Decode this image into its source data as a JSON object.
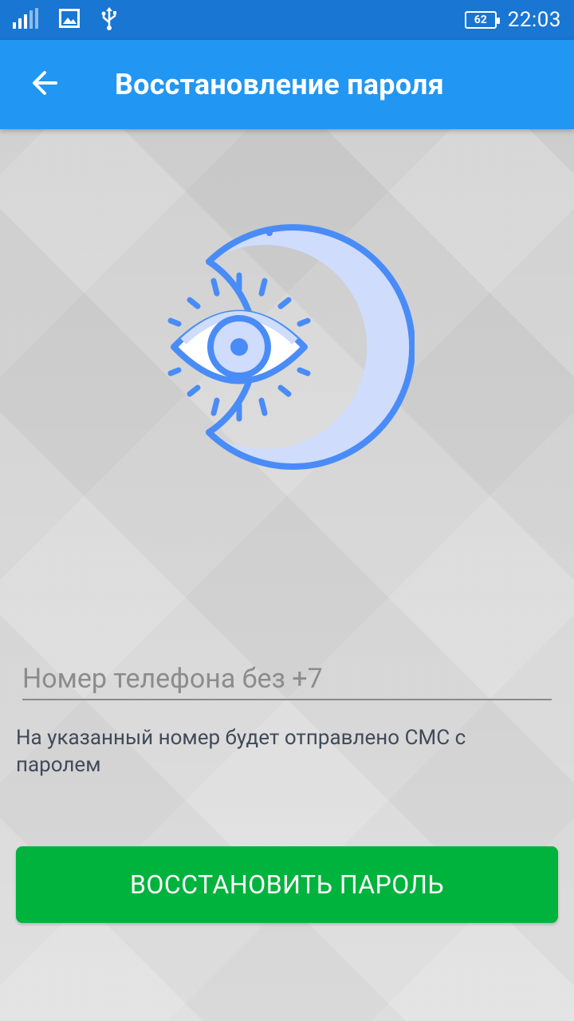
{
  "status_bar": {
    "icons": [
      "signal-icon",
      "image-icon",
      "usb-icon"
    ],
    "battery_level": "62",
    "time": "22:03"
  },
  "app_bar": {
    "back_icon": "arrow-left-icon",
    "title": "Восстановление пароля"
  },
  "illustration": {
    "icon": "eye-moon-icon",
    "colors": {
      "stroke": "#4a8cf7",
      "fill": "#cfdcfb",
      "shade": "#a9c4f9"
    }
  },
  "form": {
    "phone_placeholder": "Номер телефона без +7",
    "phone_value": "",
    "hint": "На указанный номер будет отправлено СМС с паролем",
    "submit_label": "ВОССТАНОВИТЬ ПАРОЛЬ"
  },
  "colors": {
    "status_bar": "#1976d2",
    "app_bar": "#2196f3",
    "button": "#00b33c"
  }
}
